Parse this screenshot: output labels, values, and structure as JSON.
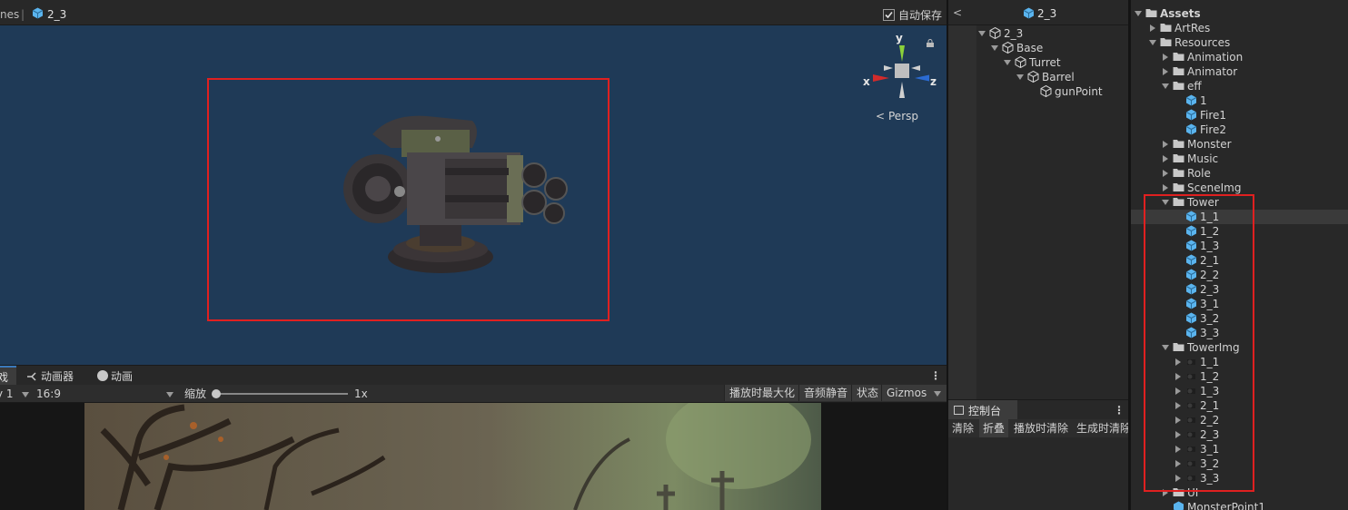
{
  "scene_tab": {
    "prev_tab": "nes",
    "sep": "|",
    "title": "2_3",
    "autosave": "自动保存"
  },
  "gizmo": {
    "y": "y",
    "x": "x",
    "z": "z",
    "persp": "Persp"
  },
  "game_tabs": {
    "first": "戏",
    "animator": "动画器",
    "animation": "动画"
  },
  "game_toolbar": {
    "display": "y 1",
    "aspect": "16:9",
    "zoom_label": "缩放",
    "zoom_value": "1x",
    "maximize": "播放时最大化",
    "mute": "音频静音",
    "stats": "状态",
    "gizmos": "Gizmos"
  },
  "hierarchy": {
    "header": "2_3",
    "items": [
      "2_3",
      "Base",
      "Turret",
      "Barrel",
      "gunPoint"
    ]
  },
  "console": {
    "title": "控制台",
    "clear": "清除",
    "collapse": "折叠",
    "clear_on_play": "播放时清除",
    "clear_on_build": "生成时清除"
  },
  "project": {
    "root": "Assets",
    "artres": "ArtRes",
    "resources": "Resources",
    "animation": "Animation",
    "animator": "Animator",
    "eff": "eff",
    "eff_items": [
      "1",
      "Fire1",
      "Fire2"
    ],
    "monster": "Monster",
    "music": "Music",
    "role": "Role",
    "sceneimg": "SceneImg",
    "tower": "Tower",
    "tower_items": [
      "1_1",
      "1_2",
      "1_3",
      "2_1",
      "2_2",
      "2_3",
      "3_1",
      "3_2",
      "3_3"
    ],
    "towerimg": "TowerImg",
    "towerimg_items": [
      "1_1",
      "1_2",
      "1_3",
      "2_1",
      "2_2",
      "2_3",
      "3_1",
      "3_2",
      "3_3"
    ],
    "ui": "UI",
    "monsterpoint": "MonsterPoint1"
  },
  "colors": {
    "scene_bg": "#1f3a57",
    "highlight_red": "#e02020",
    "prefab_blue": "#5ab4ee"
  }
}
